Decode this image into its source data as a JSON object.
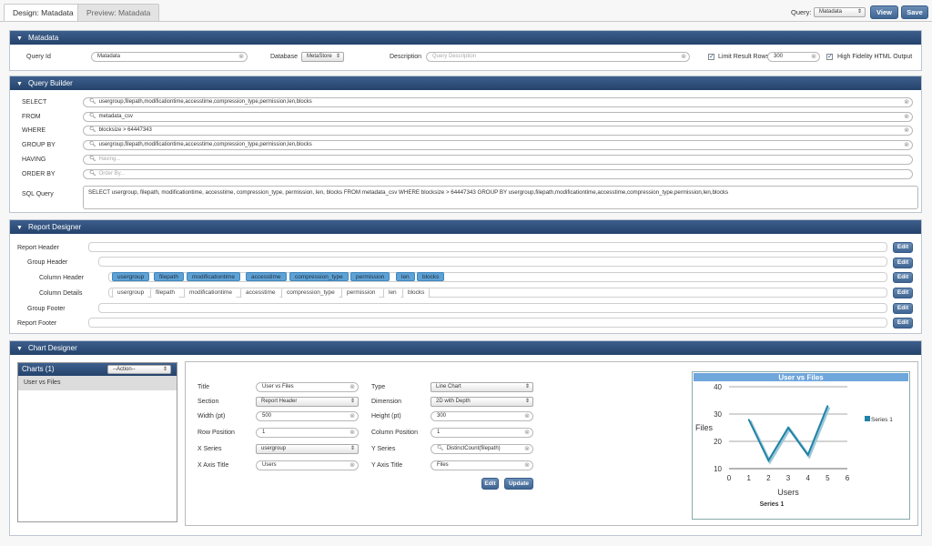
{
  "tabs": {
    "design": "Design: Matadata",
    "preview": "Preview: Matadata"
  },
  "toolbar": {
    "query_label": "Query:",
    "query_value": "Matadata",
    "view_label": "View",
    "save_label": "Save"
  },
  "metadata": {
    "header": "Matadata",
    "query_id_label": "Query Id",
    "query_id_value": "Matadata",
    "database_label": "Database",
    "database_value": "MetaStore",
    "description_label": "Description",
    "description_placeholder": "Query Description",
    "limit_label": "Limit Result Rows",
    "limit_value": "300",
    "hifi_label": "High Fidelity HTML Output"
  },
  "query_builder": {
    "header": "Query Builder",
    "select_label": "SELECT",
    "select_value": "usergroup,filepath,modificationtime,accesstime,compression_type,permission,len,blocks",
    "from_label": "FROM",
    "from_value": "metadata_csv",
    "where_label": "WHERE",
    "where_value": "blocksize >   64447343",
    "groupby_label": "GROUP BY",
    "groupby_value": "usergroup,filepath,modificationtime,accesstime,compression_type,permission,len,blocks",
    "having_label": "HAVING",
    "having_placeholder": "Having...",
    "orderby_label": "ORDER BY",
    "orderby_placeholder": "Order By...",
    "sql_label": "SQL Query",
    "sql_value": "SELECT usergroup, filepath, modificationtime, accesstime, compression_type, permission, len, blocks  FROM metadata_csv WHERE blocksize >   64447343   GROUP BY usergroup,filepath,modificationtime,accesstime,compression_type,permission,len,blocks"
  },
  "report_designer": {
    "header": "Report Designer",
    "rows": [
      "Report Header",
      "Group Header",
      "Column Header",
      "Column Details",
      "Group Footer",
      "Report Footer"
    ],
    "edit_label": "Edit",
    "columns": [
      "usergroup",
      "filepath",
      "modificationtime",
      "accesstime",
      "compression_type",
      "permission",
      "len",
      "blocks"
    ]
  },
  "chart_designer": {
    "header": "Chart Designer",
    "charts_title": "Charts (1)",
    "action_label": "--Action--",
    "charts_list": [
      "User vs Files"
    ],
    "form": {
      "title_label": "Title",
      "title_value": "User vs Files",
      "type_label": "Type",
      "type_value": "Line Chart",
      "section_label": "Section",
      "section_value": "Report Header",
      "dimension_label": "Dimension",
      "dimension_value": "2D with Depth",
      "width_label": "Width (pt)",
      "width_value": "500",
      "height_label": "Height (pt)",
      "height_value": "300",
      "rowpos_label": "Row Position",
      "rowpos_value": "1",
      "colpos_label": "Column Position",
      "colpos_value": "1",
      "xseries_label": "X Series",
      "xseries_value": "usergroup",
      "yseries_label": "Y Series",
      "yseries_value": "DistinctCount(filepath)",
      "xaxis_label": "X Axis Title",
      "xaxis_value": "Users",
      "yaxis_label": "Y Axis Title",
      "yaxis_value": "Files",
      "edit_label": "Edit",
      "update_label": "Update"
    }
  },
  "chart_data": {
    "type": "line",
    "title": "User vs Files",
    "xlabel": "Users",
    "ylabel": "Files",
    "x_ticks": [
      "0",
      "1",
      "2",
      "3",
      "4",
      "5",
      "6"
    ],
    "y_ticks": [
      "10",
      "20",
      "30",
      "40"
    ],
    "xlim": [
      0,
      6
    ],
    "ylim": [
      10,
      40
    ],
    "series": [
      {
        "name": "Series 1",
        "x": [
          1,
          2,
          3,
          4,
          5
        ],
        "y": [
          28,
          13,
          25,
          15,
          33
        ]
      }
    ],
    "footer": "Series 1",
    "color": "#1f82a6",
    "grid": true,
    "legend": "right"
  }
}
